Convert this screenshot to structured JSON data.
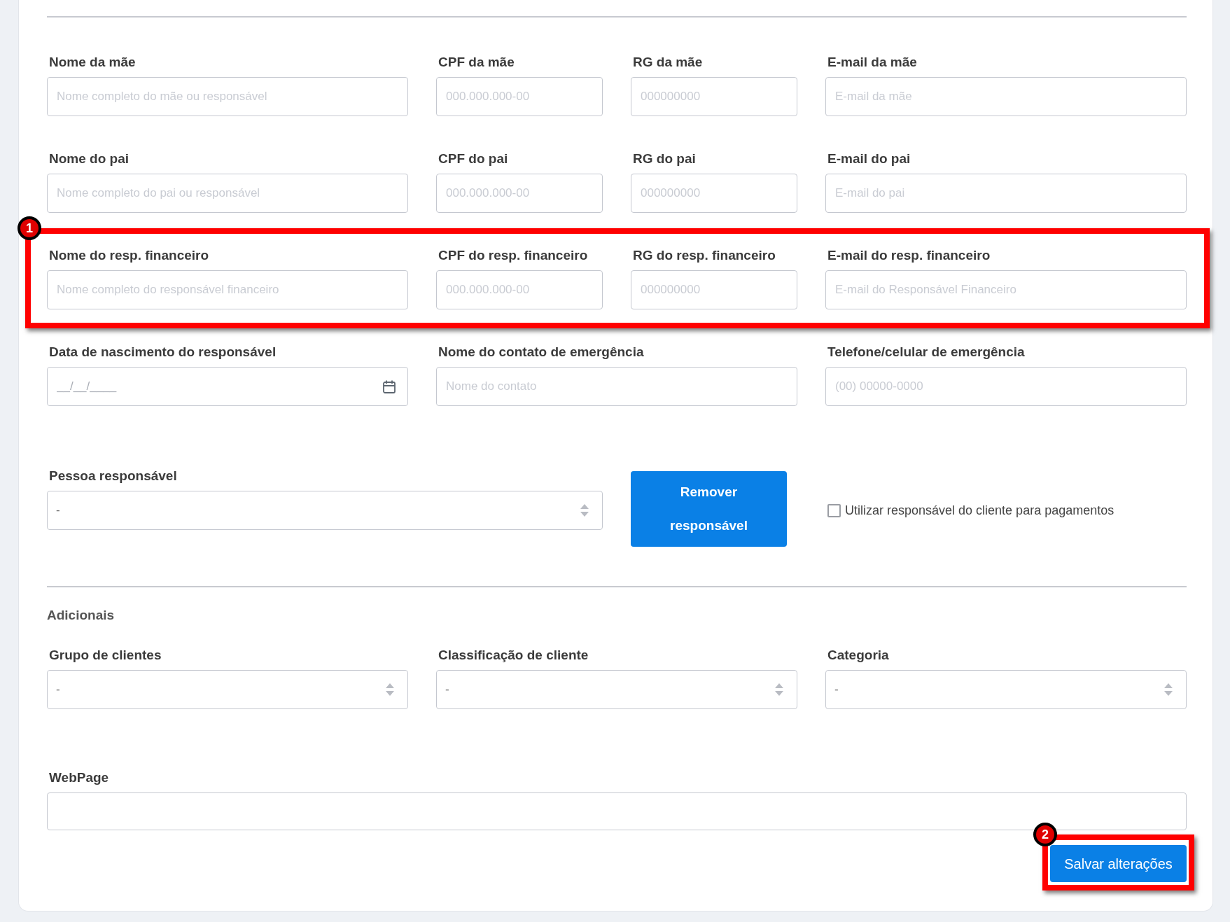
{
  "responsible_rows": [
    {
      "fields": [
        {
          "kind": "text",
          "label": "Nome da mãe",
          "placeholder": "Nome completo do mãe ou responsável"
        },
        {
          "kind": "text",
          "label": "CPF da mãe",
          "placeholder": "000.000.000-00"
        },
        {
          "kind": "text",
          "label": "RG da mãe",
          "placeholder": "000000000"
        },
        {
          "kind": "text",
          "label": "E-mail da mãe",
          "placeholder": "E-mail da mãe"
        }
      ]
    },
    {
      "fields": [
        {
          "kind": "text",
          "label": "Nome do pai",
          "placeholder": "Nome completo do pai ou responsável"
        },
        {
          "kind": "text",
          "label": "CPF do pai",
          "placeholder": "000.000.000-00"
        },
        {
          "kind": "text",
          "label": "RG do pai",
          "placeholder": "000000000"
        },
        {
          "kind": "text",
          "label": "E-mail do pai",
          "placeholder": "E-mail do pai"
        }
      ]
    },
    {
      "annotation": "1",
      "fields": [
        {
          "kind": "text",
          "label": "Nome do resp. financeiro",
          "placeholder": "Nome completo do responsável financeiro"
        },
        {
          "kind": "text",
          "label": "CPF do resp. financeiro",
          "placeholder": "000.000.000-00"
        },
        {
          "kind": "text",
          "label": "RG do resp. financeiro",
          "placeholder": "000000000"
        },
        {
          "kind": "text",
          "label": "E-mail do resp. financeiro",
          "placeholder": "E-mail do Responsável Financeiro"
        }
      ]
    },
    {
      "fields": [
        {
          "kind": "date",
          "label": "Data de nascimento do responsável",
          "placeholder": "__/__/____"
        },
        {
          "kind": "text",
          "label": "Nome do contato de emergência",
          "placeholder": "Nome do contato"
        },
        {
          "kind": "text",
          "label": "Telefone/celular de emergência",
          "placeholder": "(00) 00000-0000"
        }
      ]
    }
  ],
  "responsible_person": {
    "label": "Pessoa responsável",
    "value": "-"
  },
  "remove_button": "Remover responsável",
  "use_client_responsible": {
    "label": "Utilizar responsável do cliente para pagamentos",
    "checked": false
  },
  "additional": {
    "title": "Adicionais",
    "fields": [
      {
        "kind": "select",
        "label": "Grupo de clientes",
        "value": "-"
      },
      {
        "kind": "select",
        "label": "Classificação de cliente",
        "value": "-"
      },
      {
        "kind": "select",
        "label": "Categoria",
        "value": "-"
      }
    ]
  },
  "webpage": {
    "label": "WebPage"
  },
  "save_button": {
    "label": "Salvar alterações",
    "annotation": "2"
  }
}
